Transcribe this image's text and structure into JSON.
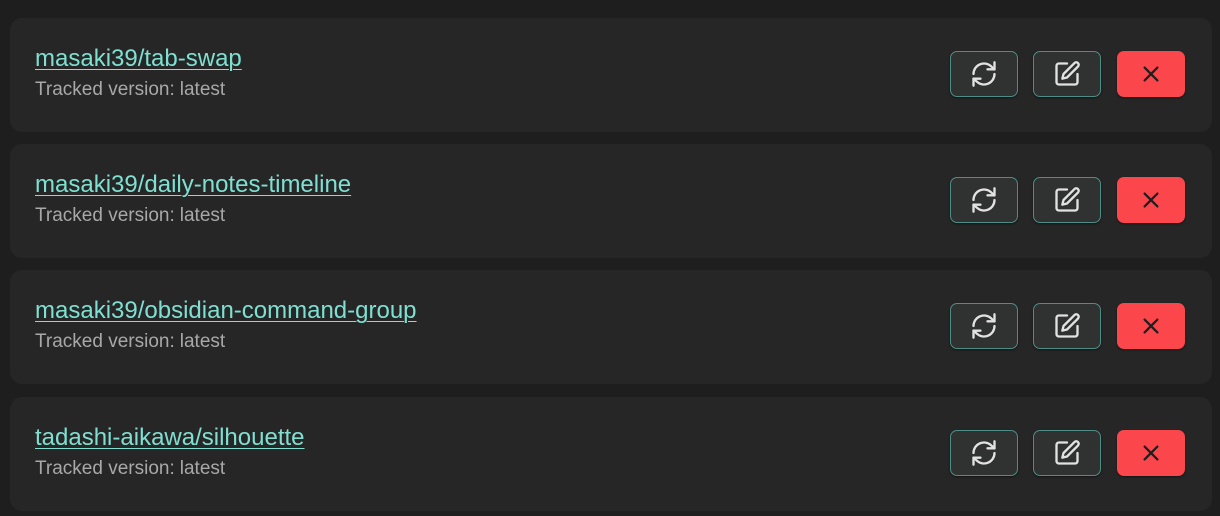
{
  "plugins": [
    {
      "repo": "masaki39/tab-swap",
      "tracked_label": "Tracked version:",
      "tracked_value": "latest"
    },
    {
      "repo": "masaki39/daily-notes-timeline",
      "tracked_label": "Tracked version:",
      "tracked_value": "latest"
    },
    {
      "repo": "masaki39/obsidian-command-group",
      "tracked_label": "Tracked version:",
      "tracked_value": "latest"
    },
    {
      "repo": "tadashi-aikawa/silhouette",
      "tracked_label": "Tracked version:",
      "tracked_value": "latest"
    }
  ],
  "buttons": {
    "check_update_icon": "refresh-icon",
    "edit_icon": "edit-icon",
    "delete_icon": "close-icon"
  },
  "colors": {
    "background": "#1e1e1e",
    "row_background": "#262626",
    "link": "#7fe0d2",
    "secondary_text": "#a8a8a8",
    "button_border": "#4f8e86",
    "delete_button": "#fb464c"
  }
}
